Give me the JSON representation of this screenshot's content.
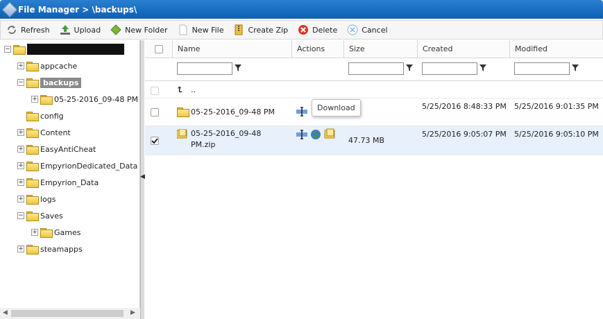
{
  "title": "File Manager > \\backups\\",
  "toolbar": {
    "refresh": "Refresh",
    "upload": "Upload",
    "new_folder": "New Folder",
    "new_file": "New File",
    "create_zip": "Create Zip",
    "delete": "Delete",
    "cancel": "Cancel"
  },
  "tree": {
    "items": [
      {
        "label": "appcache"
      },
      {
        "label": "backups"
      },
      {
        "label": "05-25-2016_09-48 PM"
      },
      {
        "label": "config"
      },
      {
        "label": "Content"
      },
      {
        "label": "EasyAntiCheat"
      },
      {
        "label": "EmpyrionDedicated_Data"
      },
      {
        "label": "Empyrion_Data"
      },
      {
        "label": "logs"
      },
      {
        "label": "Saves"
      },
      {
        "label": "Games"
      },
      {
        "label": "steamapps"
      }
    ]
  },
  "grid": {
    "columns": {
      "name": "Name",
      "actions": "Actions",
      "size": "Size",
      "created": "Created",
      "modified": "Modified"
    },
    "parent_label": "..",
    "rows": [
      {
        "name": "05-25-2016_09-48 PM",
        "size": "",
        "created": "5/25/2016 8:48:33 PM",
        "modified": "5/25/2016 9:01:35 PM",
        "checked": false
      },
      {
        "name": "05-25-2016_09-48 PM.zip",
        "size": "47.73 MB",
        "created": "5/25/2016 9:05:07 PM",
        "modified": "5/25/2016 9:05:10 PM",
        "checked": true
      }
    ]
  },
  "tooltip": "Download",
  "colors": {
    "titlebar": "#1a6fc4",
    "selected_row": "#e8f0fb",
    "selected_node": "#8a8a8a"
  }
}
